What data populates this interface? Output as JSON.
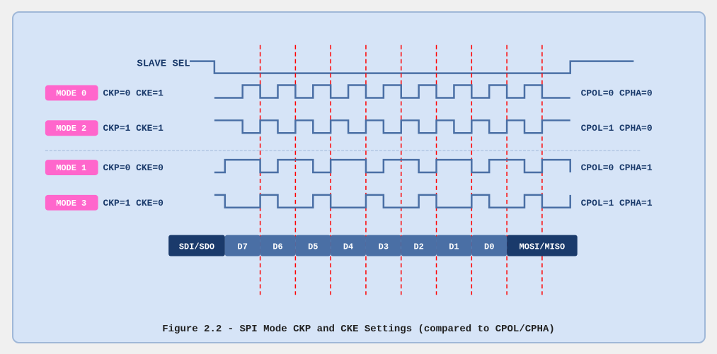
{
  "caption": "Figure 2.2 - SPI Mode CKP and CKE Settings (compared to CPOL/CPHA)",
  "diagram": {
    "slave_sel_label": "SLAVE SEL",
    "modes": [
      {
        "id": "MODE 0",
        "ckp": "CKP=0",
        "cke": "CKE=1",
        "cpol": "CPOL=0",
        "cpha": "CPHA=0"
      },
      {
        "id": "MODE 2",
        "ckp": "CKP=1",
        "cke": "CKE=1",
        "cpol": "CPOL=1",
        "cpha": "CPHA=0"
      },
      {
        "id": "MODE 1",
        "ckp": "CKP=0",
        "cke": "CKE=0",
        "cpol": "CPOL=0",
        "cpha": "CPHA=1"
      },
      {
        "id": "MODE 3",
        "ckp": "CKP=1",
        "cke": "CKE=0",
        "cpol": "CPOL=1",
        "cpha": "CPHA=1"
      }
    ],
    "data_bits": [
      "SDI/SDO",
      "D7",
      "D6",
      "D5",
      "D4",
      "D3",
      "D2",
      "D1",
      "D0",
      "MOSI/MISO"
    ]
  }
}
